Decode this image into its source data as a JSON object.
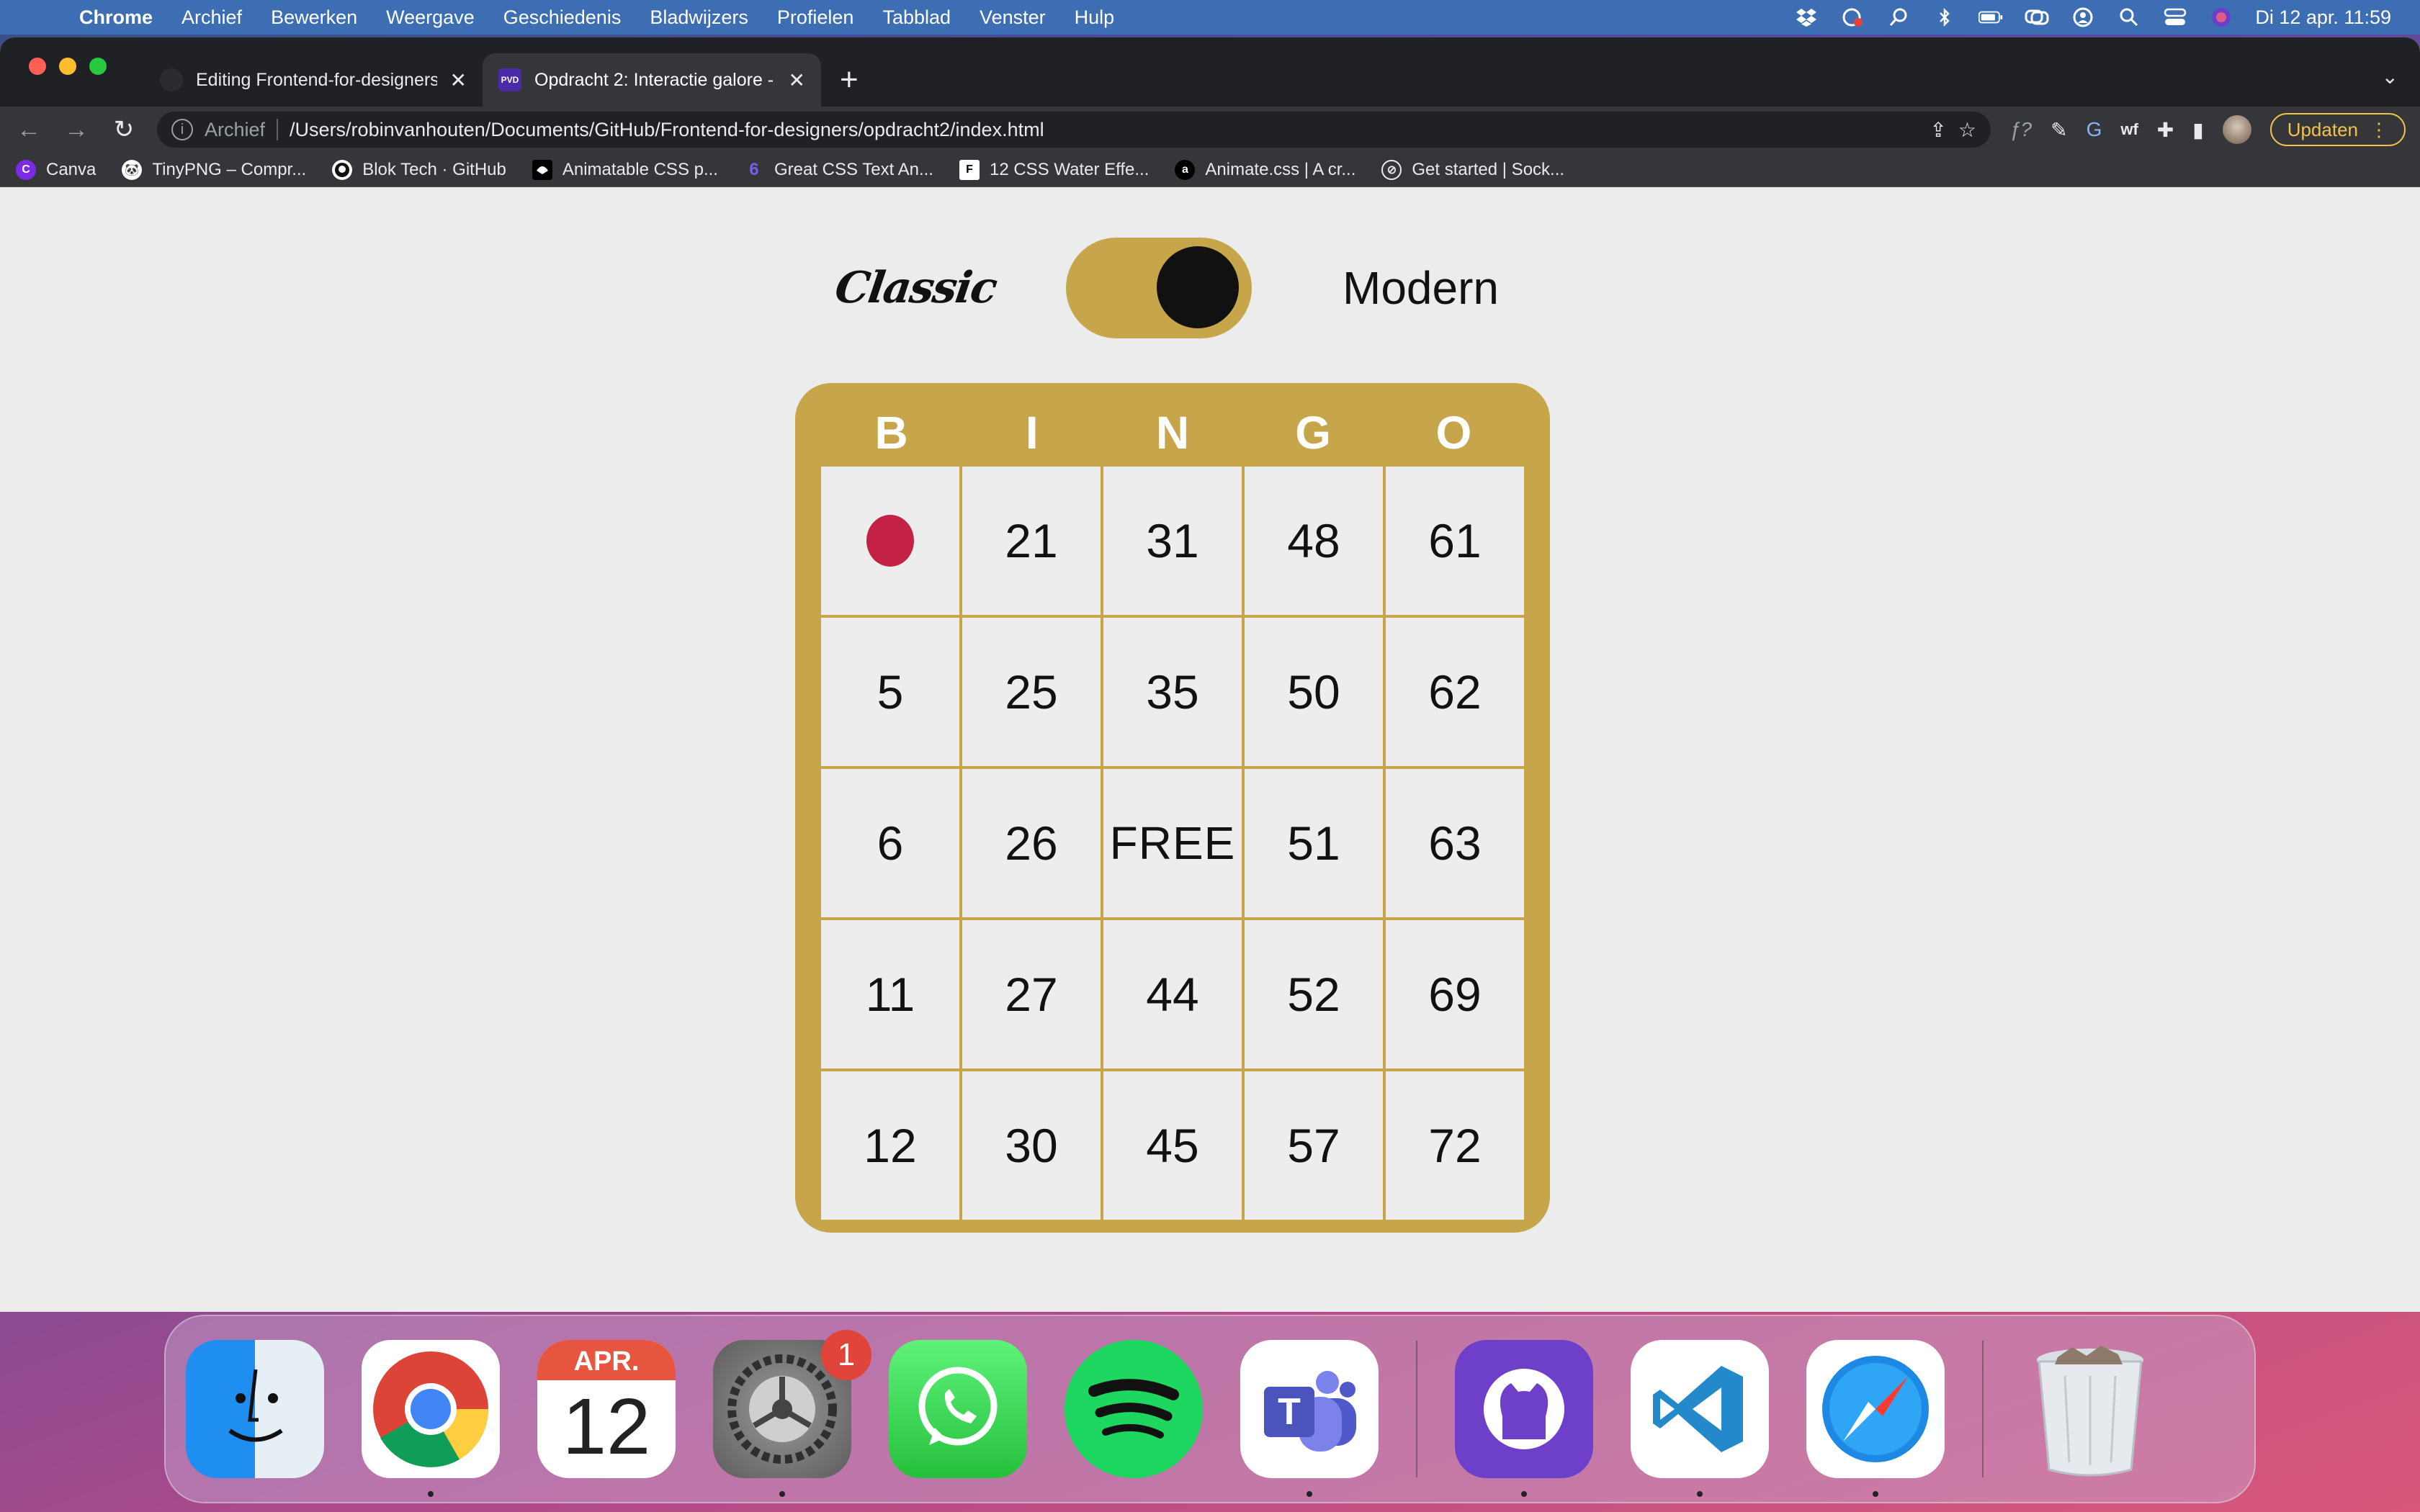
{
  "menubar": {
    "app_name": "Chrome",
    "menus": [
      "Archief",
      "Bewerken",
      "Weergave",
      "Geschiedenis",
      "Bladwijzers",
      "Profielen",
      "Tabblad",
      "Venster",
      "Hulp"
    ],
    "clock": "Di 12 apr.  11:59"
  },
  "tabs": [
    {
      "title": "Editing Frontend-for-designers"
    },
    {
      "title": "Opdracht 2: Interactie galore -",
      "favicon_text": "PVD"
    }
  ],
  "toolbar": {
    "chip": "Archief",
    "url": "/Users/robinvanhouten/Documents/GitHub/Frontend-for-designers/opdracht2/index.html",
    "update_label": "Updaten"
  },
  "bookmarks": [
    {
      "label": "Canva",
      "icon_text": "C",
      "color": "#7d2ae8"
    },
    {
      "label": "TinyPNG – Compr...",
      "icon_text": "🐼",
      "color": "#ffffff"
    },
    {
      "label": "Blok Tech · GitHub",
      "icon_text": "",
      "color": "#ffffff"
    },
    {
      "label": "Animatable CSS p...",
      "icon_text": "",
      "color": "#000000"
    },
    {
      "label": "Great CSS Text An...",
      "icon_text": "6",
      "color": "#5b3cc4"
    },
    {
      "label": "12 CSS Water Effe...",
      "icon_text": "F",
      "color": "#ffffff"
    },
    {
      "label": "Animate.css | A cr...",
      "icon_text": "a",
      "color": "#000000"
    },
    {
      "label": "Get started | Sock...",
      "icon_text": "⊘",
      "color": "#35363a"
    }
  ],
  "page": {
    "toggle": {
      "left_label": "Classic",
      "right_label": "Modern",
      "state": "modern"
    },
    "bingo": {
      "header": [
        "B",
        "I",
        "N",
        "G",
        "O"
      ],
      "rows": [
        [
          "",
          "21",
          "31",
          "48",
          "61"
        ],
        [
          "5",
          "25",
          "35",
          "50",
          "62"
        ],
        [
          "6",
          "26",
          "FREE",
          "51",
          "63"
        ],
        [
          "11",
          "27",
          "44",
          "52",
          "69"
        ],
        [
          "12",
          "30",
          "45",
          "57",
          "72"
        ]
      ],
      "marked_cell": "row 1, column B",
      "colors": {
        "card": "#c6a54b",
        "cell": "#ededed",
        "marker": "#c42146"
      }
    }
  },
  "dock": {
    "apps": [
      {
        "name": "Finder"
      },
      {
        "name": "Chrome"
      },
      {
        "name": "Calendar",
        "month": "APR.",
        "day": "12"
      },
      {
        "name": "System Settings",
        "badge": "1"
      },
      {
        "name": "WhatsApp"
      },
      {
        "name": "Spotify"
      },
      {
        "name": "Teams"
      },
      {
        "name": "GitHub Desktop"
      },
      {
        "name": "VS Code"
      },
      {
        "name": "Safari"
      },
      {
        "name": "Trash"
      }
    ]
  }
}
